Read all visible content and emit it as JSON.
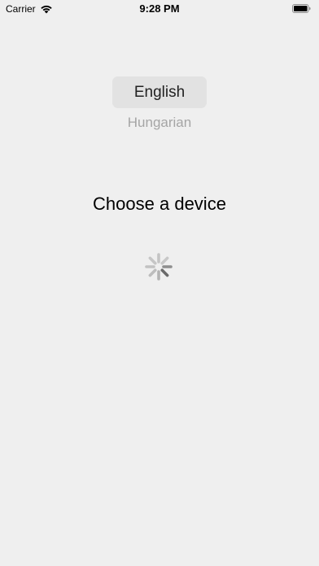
{
  "status_bar": {
    "carrier": "Carrier",
    "time": "9:28 PM",
    "icons": [
      "wifi-icon",
      "battery-icon"
    ]
  },
  "languages": {
    "selected": "English",
    "other": "Hungarian"
  },
  "main": {
    "title": "Choose a device",
    "loading_indicator": "spinner-icon"
  },
  "colors": {
    "background": "#efefef",
    "selected_pill": "#e2e2e2",
    "unselected_text": "#a5a5a5"
  }
}
